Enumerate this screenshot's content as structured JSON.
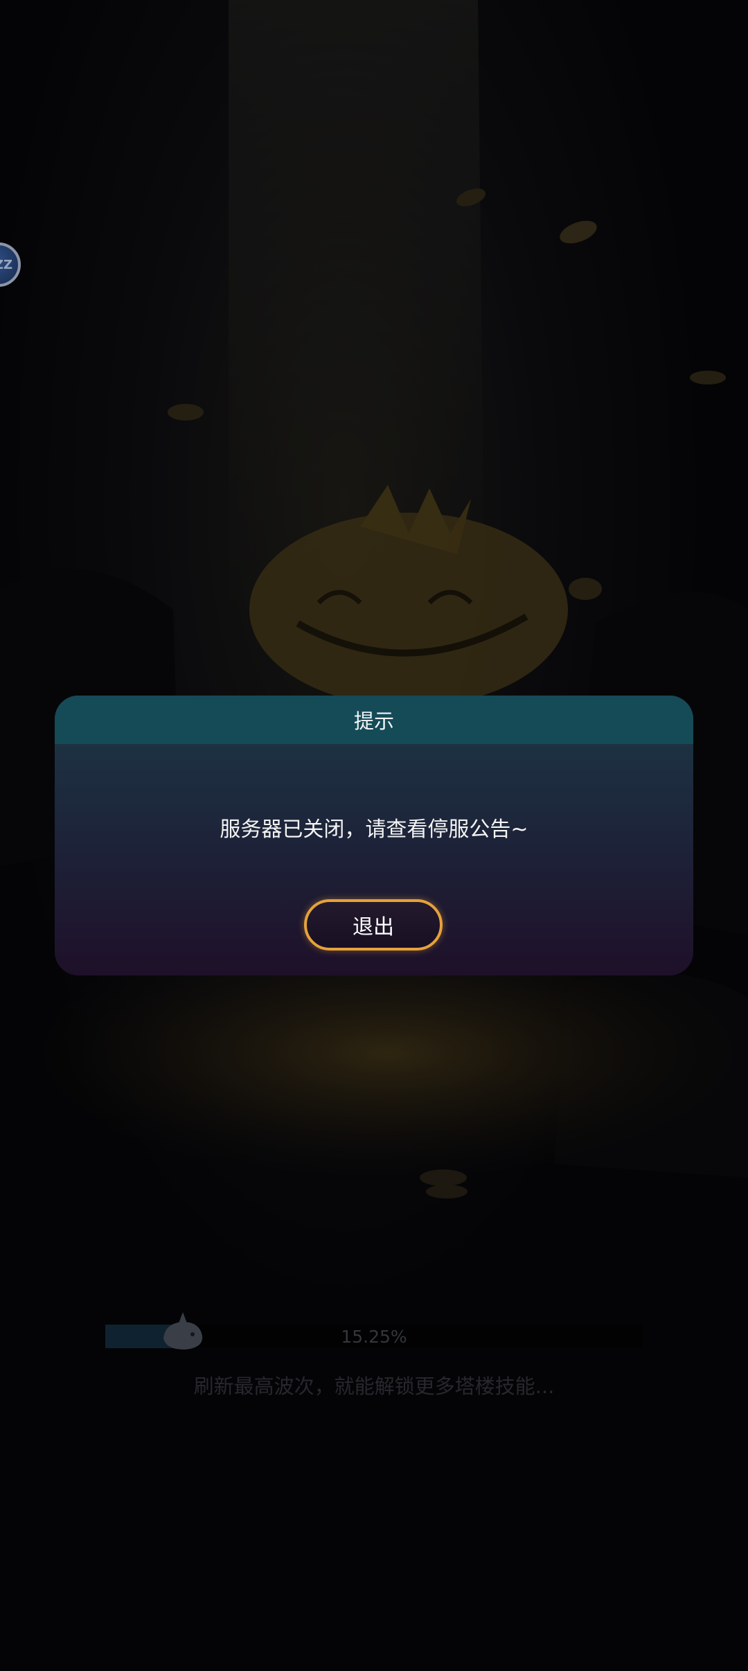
{
  "dialog": {
    "title": "提示",
    "message": "服务器已关闭，请查看停服公告~",
    "exit_label": "退出"
  },
  "float_ball": {
    "label": "ZZ"
  },
  "loading": {
    "progress": 15.25,
    "progress_label": "15.25%",
    "tip": "刷新最高波次，就能解锁更多塔楼技能..."
  },
  "colors": {
    "dialog_header": "#154b57",
    "button_border": "#e6a23a",
    "background": "#07070b"
  }
}
